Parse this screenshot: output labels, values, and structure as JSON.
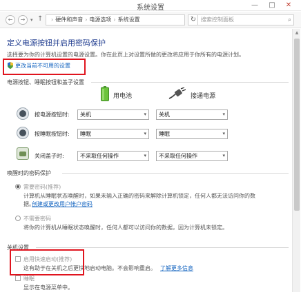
{
  "window": {
    "title": "系统设置",
    "minimize_glyph": "—",
    "maximize_glyph": "□",
    "close_glyph": "✕"
  },
  "nav": {
    "back_glyph": "←",
    "forward_glyph": "→",
    "recent_glyph": "▾",
    "up_glyph": "↑",
    "breadcrumb": [
      "硬件和声音",
      "电源选项",
      "系统设置"
    ],
    "separator": "›",
    "refresh_glyph": "↻",
    "search_placeholder": "搜索控制面板",
    "search_glyph": "⌕"
  },
  "page": {
    "heading": "定义电源按钮并启用密码保护",
    "description": "选择要为你的计算机设置的电源设置。你在此页上对设置所做的更改将应用于你所有的电源计划。",
    "unavailable_link": "更改当前不可用的设置"
  },
  "power_buttons": {
    "section_title": "电源按钮、睡眠按钮和盖子设置",
    "col_battery": "用电池",
    "col_plugged": "接通电源",
    "rows": [
      {
        "label": "按电源按钮时:",
        "battery": "关机",
        "plugged": "关机",
        "icon": "power-icon"
      },
      {
        "label": "按睡眠按钮时:",
        "battery": "睡眠",
        "plugged": "睡眠",
        "icon": "sleep-icon"
      },
      {
        "label": "关闭盖子时:",
        "battery": "不采取任何操作",
        "plugged": "不采取任何操作",
        "icon": "lid-icon"
      }
    ],
    "dropdown_caret": "▾"
  },
  "wake_password": {
    "section_title": "唤醒时的密码保护",
    "require": {
      "label": "需要密码(推荐)",
      "desc_line1": "计算机从睡眠状态唤醒时，如果未输入正确的密码来解除计算机锁定，任何人都无法访问你的数",
      "desc_line2": "据。",
      "link": "创建或更改用户帐户密码",
      "selected": true
    },
    "no_require": {
      "label": "不需要密码",
      "desc": "将你的计算机从睡眠状态唤醒时，任何人都可以访问你的数据，因为计算机未锁定。",
      "selected": false
    }
  },
  "shutdown": {
    "section_title": "关机设置",
    "fast_startup_label": "启用快速启动(推荐)",
    "fast_startup_desc": "这有助于在关机之后更快地启动电脑。不会影响重启。",
    "learn_more": "了解更多信息",
    "sleep_label": "睡眠",
    "sleep_desc": "显示在电源菜单中。"
  }
}
